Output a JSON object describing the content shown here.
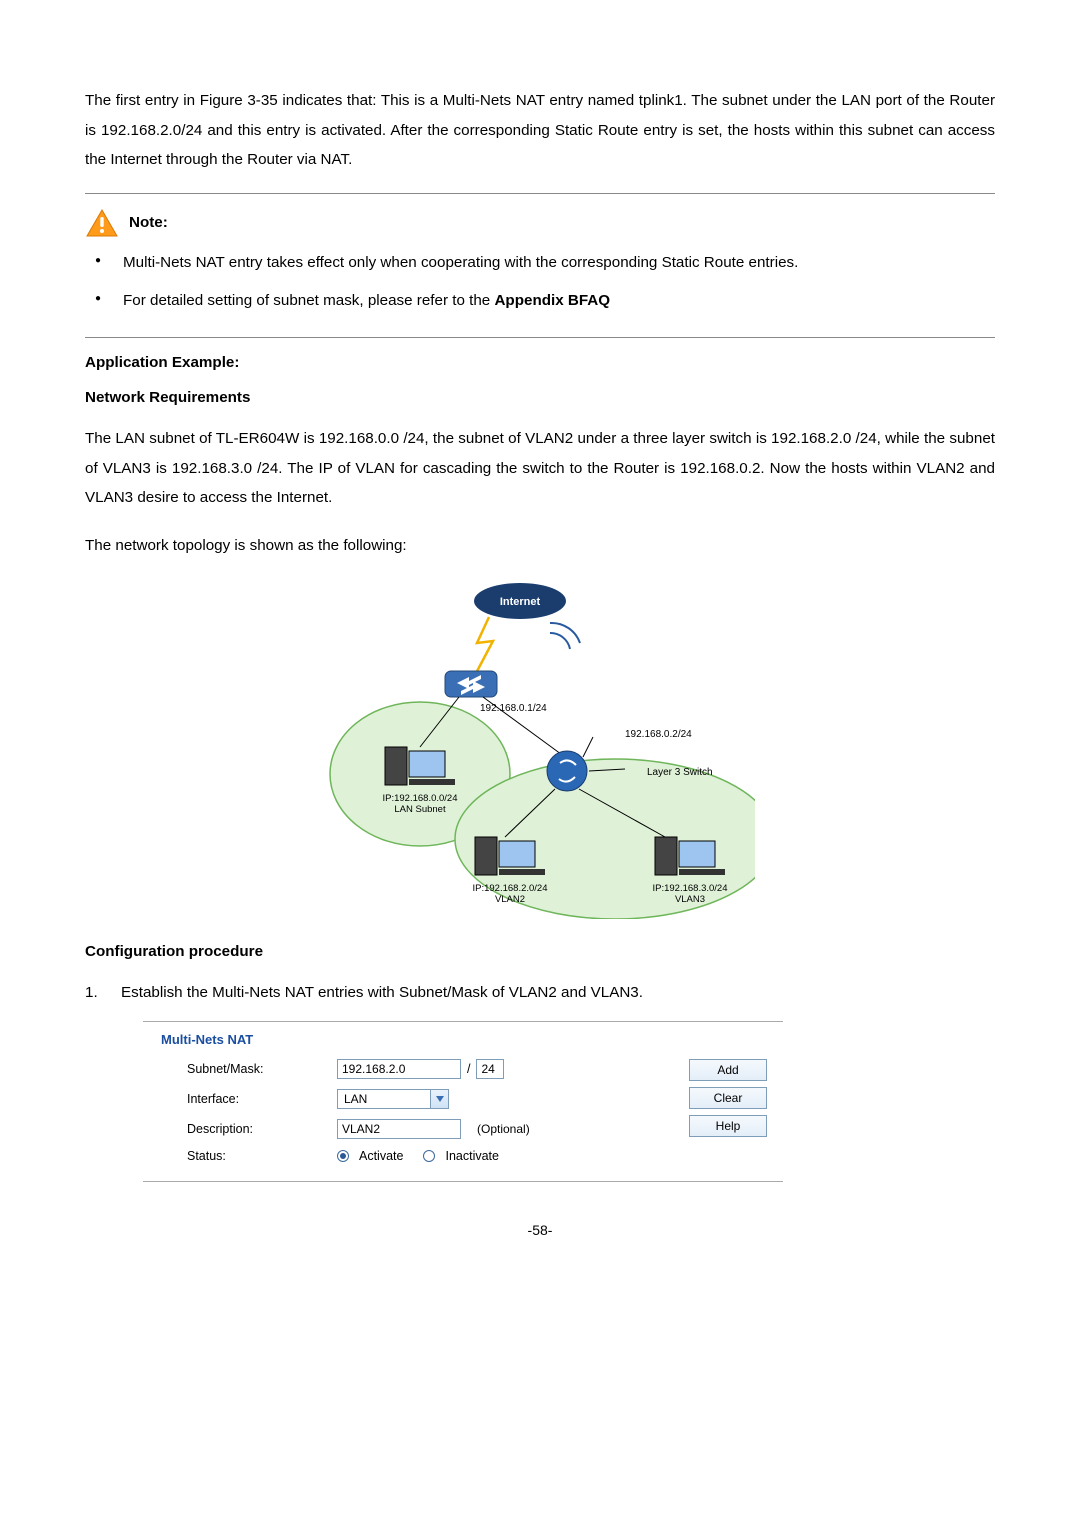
{
  "intro_paragraph": "The first entry in Figure 3-35 indicates that: This is a Multi-Nets NAT entry named tplink1. The subnet under the LAN port of the Router is 192.168.2.0/24 and this entry is activated. After the corresponding Static Route entry is set, the hosts within this subnet can access the Internet through the Router via NAT.",
  "note": {
    "label": "Note:",
    "items": [
      {
        "text_a": "Multi-Nets NAT entry takes effect only when cooperating with the corresponding Static Route entries."
      },
      {
        "text_a": "For detailed setting of subnet mask, please refer to the ",
        "bold": "Appendix BFAQ"
      }
    ]
  },
  "headings": {
    "app_example": "Application Example:",
    "net_req": "Network Requirements",
    "config_proc": "Configuration procedure"
  },
  "network_req_text": "The LAN subnet of TL-ER604W is 192.168.0.0 /24, the subnet of VLAN2 under a three layer switch is 192.168.2.0 /24, while the subnet of VLAN3 is 192.168.3.0 /24. The IP of VLAN for cascading the switch to the Router is 192.168.0.2. Now the hosts within VLAN2 and VLAN3 desire to access the Internet.",
  "topology_caption": "The network topology is shown as the following:",
  "topology": {
    "internet": "Internet",
    "router_label": "192.168.0.1/24",
    "switch_ip": "192.168.0.2/24",
    "switch_label": "Layer 3 Switch",
    "lan_host_ip": "IP:192.168.0.0/24",
    "lan_host_sub": "LAN Subnet",
    "vlan2_ip": "IP:192.168.2.0/24",
    "vlan2_sub": "VLAN2",
    "vlan3_ip": "IP:192.168.3.0/24",
    "vlan3_sub": "VLAN3"
  },
  "step1": {
    "num": "1.",
    "text": "Establish the Multi-Nets NAT entries with Subnet/Mask of VLAN2 and VLAN3."
  },
  "form": {
    "title": "Multi-Nets NAT",
    "labels": {
      "subnet": "Subnet/Mask:",
      "interface": "Interface:",
      "description": "Description:",
      "status": "Status:"
    },
    "values": {
      "subnet": "192.168.2.0",
      "mask": "24",
      "interface": "LAN",
      "description": "VLAN2",
      "optional": "(Optional)",
      "activate": "Activate",
      "inactivate": "Inactivate"
    },
    "buttons": {
      "add": "Add",
      "clear": "Clear",
      "help": "Help"
    }
  },
  "page_number": "-58-"
}
